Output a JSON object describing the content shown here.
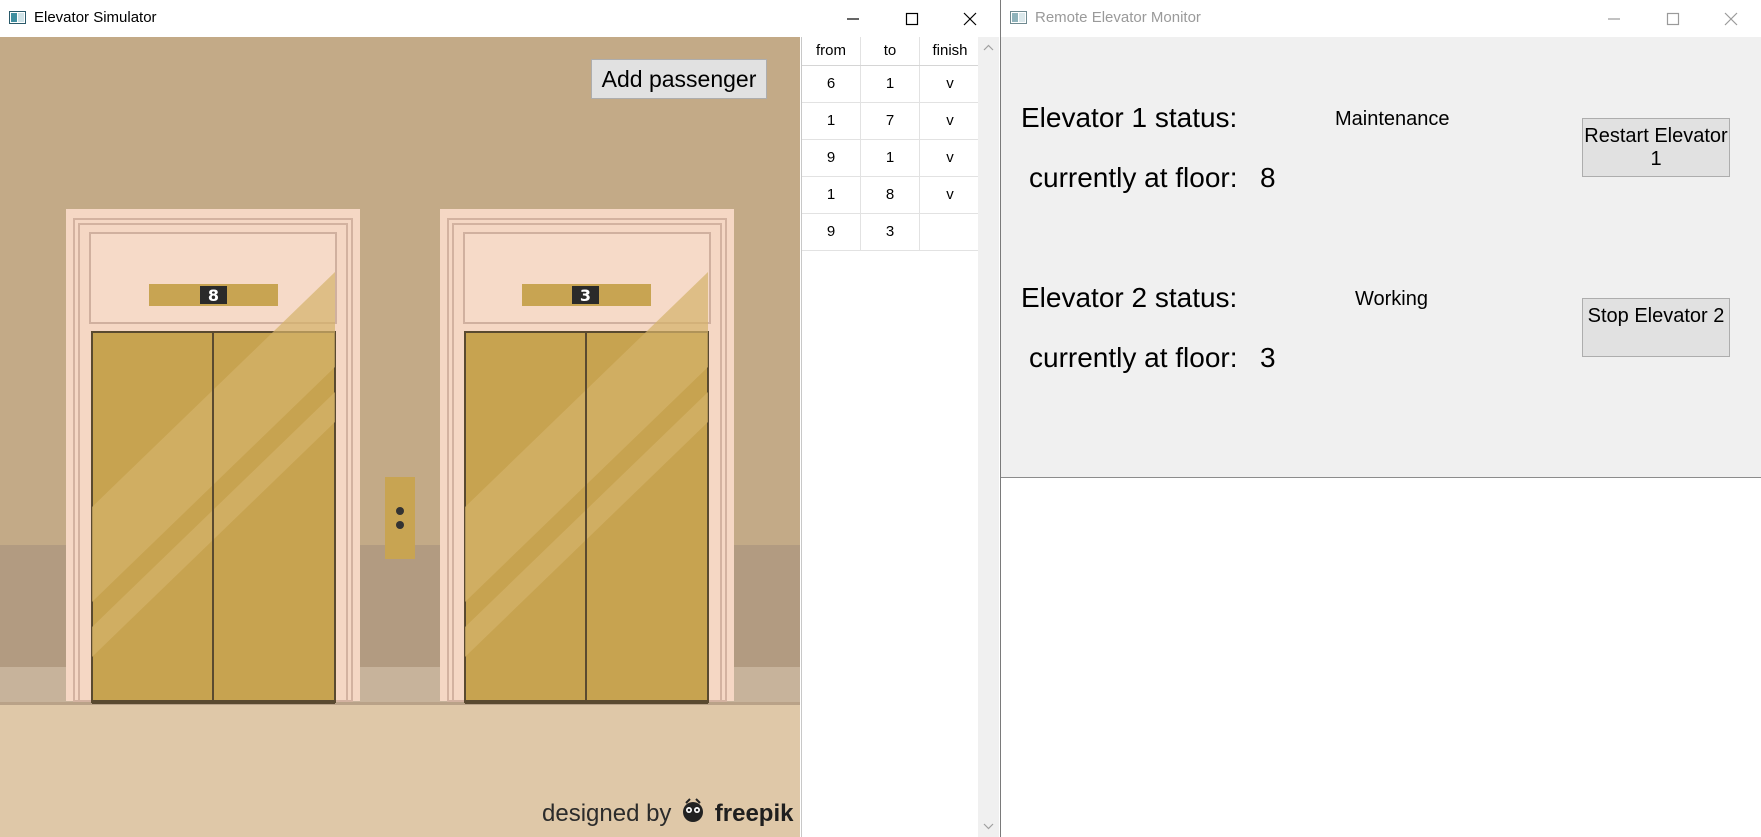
{
  "simulator": {
    "title": "Elevator Simulator",
    "add_button": "Add passenger",
    "elevators": [
      {
        "floor": "8"
      },
      {
        "floor": "3"
      }
    ],
    "credit_prefix": "designed by",
    "credit_brand": "freepik",
    "table": {
      "headers": [
        "from",
        "to",
        "finish"
      ],
      "rows": [
        [
          "6",
          "1",
          "v"
        ],
        [
          "1",
          "7",
          "v"
        ],
        [
          "9",
          "1",
          "v"
        ],
        [
          "1",
          "8",
          "v"
        ],
        [
          "9",
          "3",
          ""
        ]
      ]
    }
  },
  "monitor": {
    "title": "Remote Elevator Monitor",
    "elevators": [
      {
        "status_label": "Elevator 1 status:",
        "status": "Maintenance",
        "floor_label": "currently at floor:",
        "floor": "8",
        "button": "Restart Elevator 1"
      },
      {
        "status_label": "Elevator 2 status:",
        "status": "Working",
        "floor_label": "currently at floor:",
        "floor": "3",
        "button": "Stop Elevator 2"
      }
    ]
  }
}
